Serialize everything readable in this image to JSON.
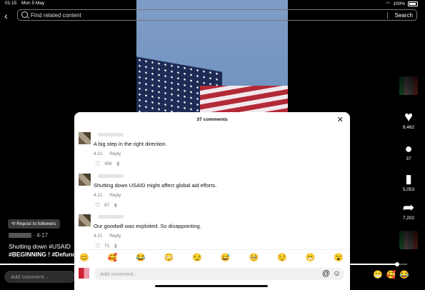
{
  "status": {
    "time": "01:15",
    "date": "Mon 5 May",
    "battery": "100%"
  },
  "search": {
    "placeholder": "Find related content",
    "button": "Search"
  },
  "rail": {
    "likes": "9,462",
    "comments": "37",
    "saves": "5,053",
    "shares": "7,202"
  },
  "overlay": {
    "repost": "Repost to followers",
    "date": "· 4-17",
    "caption_line1": "Shutting down #USAID",
    "caption_line2": "#BEGINNING ! #Defund",
    "add_comment": "Add comment...",
    "progress": 0.975
  },
  "sheet": {
    "title": "37 comments",
    "comments": [
      {
        "text": "A big step in the right direction.",
        "date": "4-21",
        "reply": "Reply",
        "likes": "456"
      },
      {
        "text": "Shutting down USAID might affect global aid efforts.",
        "date": "4-21",
        "reply": "Reply",
        "likes": "87"
      },
      {
        "text": "Our goodwill was exploited. So disappointing.",
        "date": "4-21",
        "reply": "Reply",
        "likes": "71"
      }
    ],
    "emojis": [
      "😊",
      "🥰",
      "😂",
      "😳",
      "😏",
      "😅",
      "🥺",
      "😌",
      "😬",
      "😮"
    ],
    "input_placeholder": "Add comment..."
  },
  "right_emojis": [
    "😁",
    "🥰",
    "😂"
  ]
}
